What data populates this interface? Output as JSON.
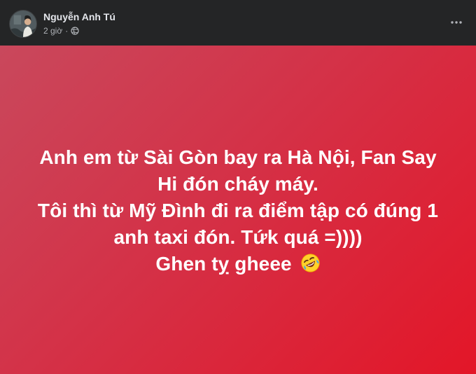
{
  "post": {
    "author": "Nguyễn Anh Tú",
    "time": "2 giờ",
    "separator": "·",
    "privacy_icon": "globe-icon",
    "more_icon": "more-horizontal-icon",
    "text_lines": [
      "Anh em từ Sài Gòn bay ra Hà Nội, Fan Say",
      "Hi đón cháy máy.",
      "Tôi thì từ Mỹ Đình đi ra điểm tập có đúng 1",
      "anh taxi đón. Tứk quá =))))",
      "Ghen tỵ gheee"
    ],
    "emoji": "rolling-on-floor-laughing-emoji",
    "colors": {
      "header_background": "#242526",
      "name": "#e4e6eb",
      "meta": "#b0b3b8",
      "gradient_start": "#c9485c",
      "gradient_end": "#e31628",
      "text": "#ffffff"
    }
  }
}
